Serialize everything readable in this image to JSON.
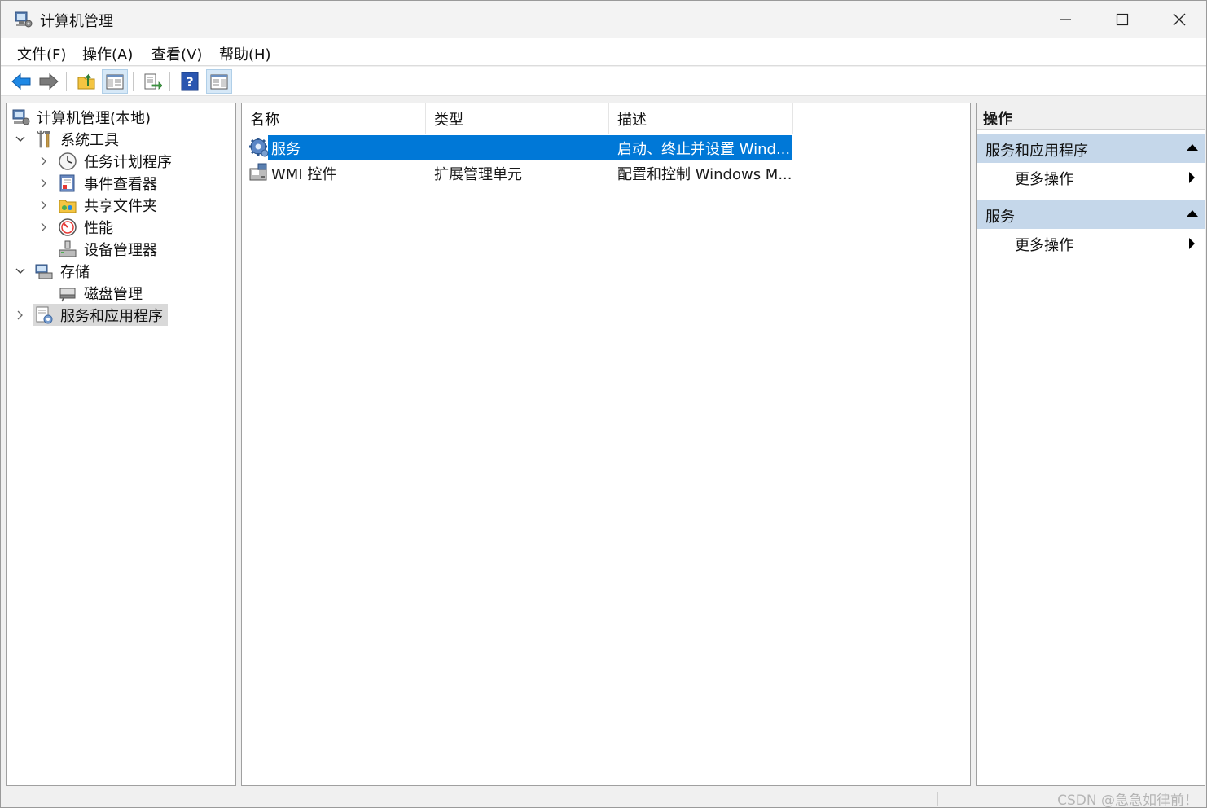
{
  "window": {
    "title": "计算机管理",
    "minimize_icon": "minimize-icon",
    "maximize_icon": "maximize-icon",
    "close_icon": "close-icon"
  },
  "menubar": {
    "items": [
      "文件(F)",
      "操作(A)",
      "查看(V)",
      "帮助(H)"
    ]
  },
  "toolbar": {
    "buttons": [
      {
        "icon": "back-arrow-icon"
      },
      {
        "icon": "forward-arrow-icon"
      },
      {
        "icon": "up-folder-icon"
      },
      {
        "icon": "show-hide-console-tree-icon",
        "pressed": true
      },
      {
        "icon": "export-list-icon"
      },
      {
        "icon": "help-icon"
      },
      {
        "icon": "show-hide-action-pane-icon",
        "pressed": true
      }
    ]
  },
  "tree": {
    "root": "计算机管理(本地)",
    "system_tools": "系统工具",
    "task_scheduler": "任务计划程序",
    "event_viewer": "事件查看器",
    "shared_folders": "共享文件夹",
    "performance": "性能",
    "device_manager": "设备管理器",
    "storage": "存储",
    "disk_management": "磁盘管理",
    "services_apps": "服务和应用程序"
  },
  "list": {
    "columns": [
      "名称",
      "类型",
      "描述"
    ],
    "rows": [
      {
        "name": "服务",
        "type": "",
        "desc": "启动、终止并设置 Wind...",
        "selected": true
      },
      {
        "name": "WMI 控件",
        "type": "扩展管理单元",
        "desc": "配置和控制 Windows M...",
        "selected": false
      }
    ]
  },
  "actions": {
    "title": "操作",
    "sections": [
      {
        "label": "服务和应用程序",
        "item": "更多操作"
      },
      {
        "label": "服务",
        "item": "更多操作"
      }
    ]
  },
  "statusbar": {
    "watermark": "CSDN @急急如律前！"
  },
  "colors": {
    "selection": "#0078d7",
    "action_section_bg": "#c5d7ea",
    "tree_selection": "#d9d9d9"
  }
}
